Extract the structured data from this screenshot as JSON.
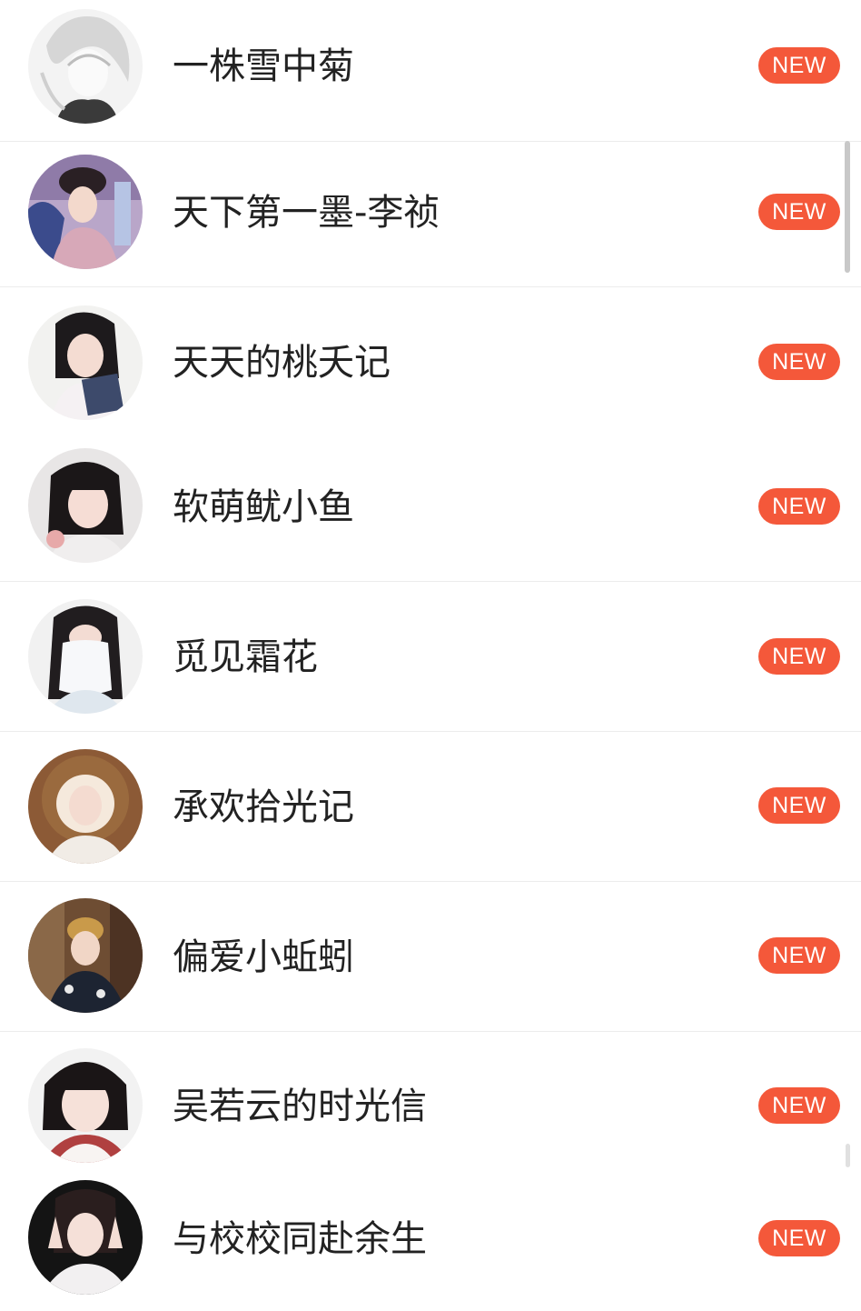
{
  "badge_color": "#f4583a",
  "items": [
    {
      "name": "一株雪中菊",
      "badge": "NEW",
      "avatar": "avatar-sketch"
    },
    {
      "name": "天下第一墨-李祯",
      "badge": "NEW",
      "avatar": "avatar-photo"
    },
    {
      "name": "天天的桃夭记",
      "badge": "NEW",
      "avatar": "avatar-photo"
    },
    {
      "name": "软萌鱿小鱼",
      "badge": "NEW",
      "avatar": "avatar-photo"
    },
    {
      "name": "觅见霜花",
      "badge": "NEW",
      "avatar": "avatar-photo"
    },
    {
      "name": "承欢拾光记",
      "badge": "NEW",
      "avatar": "avatar-photo"
    },
    {
      "name": "偏爱小蚯蚓",
      "badge": "NEW",
      "avatar": "avatar-photo"
    },
    {
      "name": "吴若云的时光信",
      "badge": "NEW",
      "avatar": "avatar-photo"
    },
    {
      "name": "与校校同赴余生",
      "badge": "NEW",
      "avatar": "avatar-photo"
    }
  ]
}
